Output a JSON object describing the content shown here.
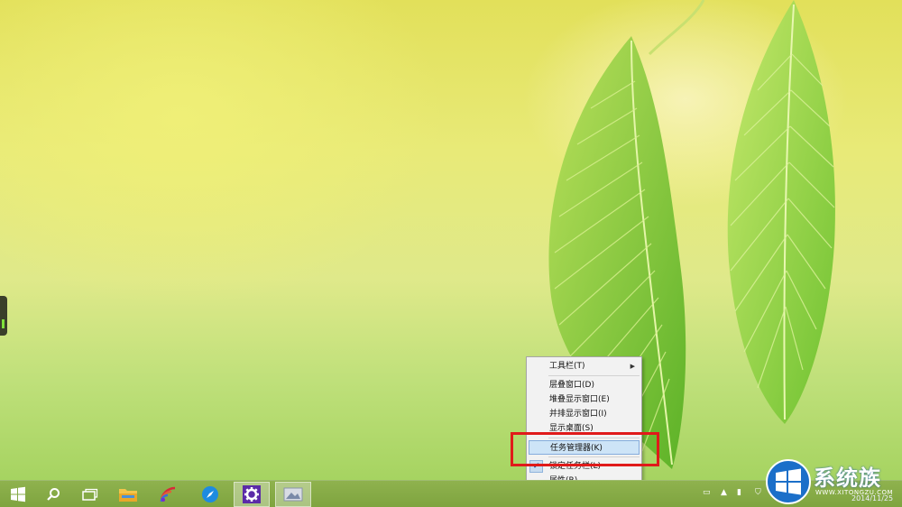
{
  "desktop": {
    "wallpaper": "green-leaf-wallpaper",
    "side_handle": "charms-handle"
  },
  "context_menu": {
    "items": [
      {
        "label": "工具栏(T)",
        "submenu": true
      },
      {
        "label": "层叠窗口(D)"
      },
      {
        "label": "堆叠显示窗口(E)"
      },
      {
        "label": "并排显示窗口(I)"
      },
      {
        "label": "显示桌面(S)"
      },
      {
        "label": "任务管理器(K)",
        "highlighted": true
      },
      {
        "label": "锁定任务栏(L)",
        "checked": true
      },
      {
        "label": "属性(R)"
      }
    ]
  },
  "taskbar": {
    "buttons": [
      {
        "name": "start",
        "icon": "windows-logo-icon"
      },
      {
        "name": "search",
        "icon": "search-icon"
      },
      {
        "name": "task-view",
        "icon": "task-view-icon"
      },
      {
        "name": "file-explorer",
        "icon": "folder-icon"
      },
      {
        "name": "app-rss",
        "icon": "rss-app-icon"
      },
      {
        "name": "app-browser",
        "icon": "compass-icon"
      },
      {
        "name": "settings",
        "icon": "gear-icon",
        "active": true
      },
      {
        "name": "photos",
        "icon": "photo-icon",
        "active": true
      }
    ],
    "tray": {
      "clock_date": "2014/11/25"
    }
  },
  "watermark": {
    "brand": "系统族",
    "url": "WWW.XITONGZU.COM"
  },
  "colors": {
    "taskbar": "#86ab45",
    "highlight": "#cde4f7",
    "annotation": "#e01a1a"
  }
}
